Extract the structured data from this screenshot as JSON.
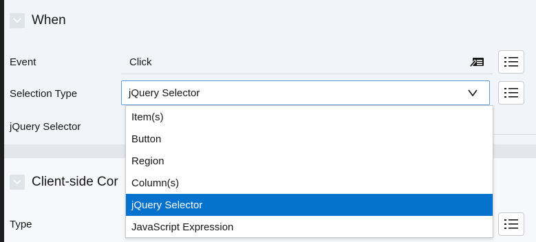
{
  "when": {
    "title": "When",
    "event_label": "Event",
    "event_value": "Click",
    "selection_type_label": "Selection Type",
    "selection_type_value": "jQuery Selector",
    "jquery_selector_label": "jQuery Selector"
  },
  "dropdown": {
    "options": [
      "Item(s)",
      "Button",
      "Region",
      "Column(s)",
      "jQuery Selector",
      "JavaScript Expression"
    ],
    "selected_index": 4
  },
  "client_side": {
    "title": "Client-side Cor",
    "type_label": "Type"
  },
  "icons": {
    "collapse": "chevron-down-icon",
    "list": "list-icon",
    "value_edit": "edit-value-icon",
    "select_chevron": "chevron-down-icon"
  },
  "colors": {
    "selection": "#0572ce",
    "focus_border": "#5b9dd9",
    "panel_bg": "#f1f5fa"
  }
}
